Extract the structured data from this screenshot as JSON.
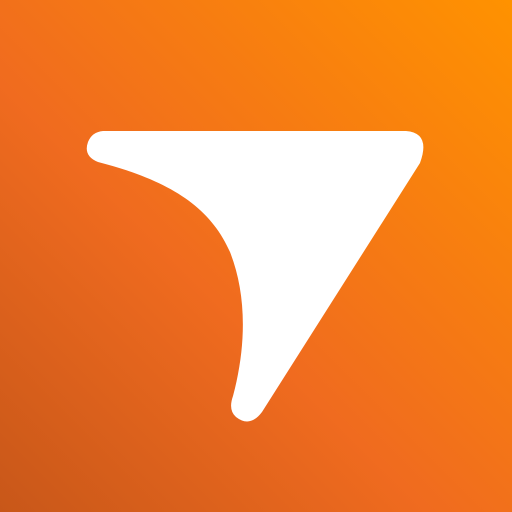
{
  "icon": {
    "name": "app-logo",
    "glyph": "pointer-arrow-icon",
    "colors": {
      "gradient_start": "#C85719",
      "gradient_mid": "#F06B1F",
      "gradient_end": "#FF9200",
      "glyph_fill": "#FFFFFF"
    }
  }
}
